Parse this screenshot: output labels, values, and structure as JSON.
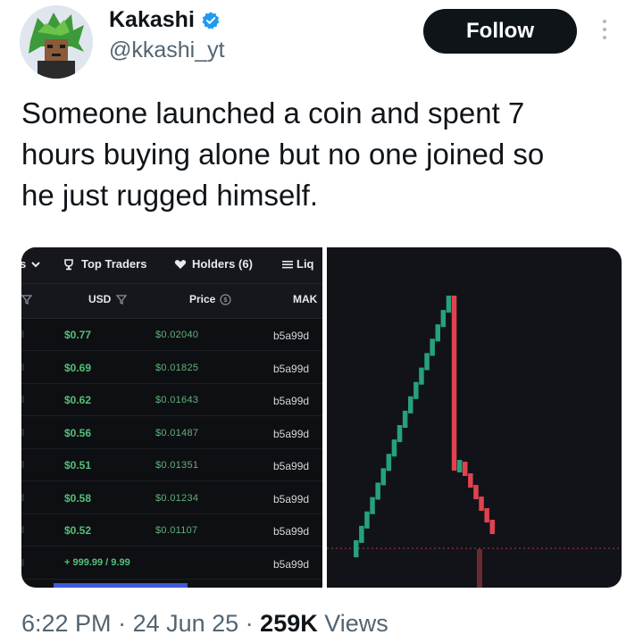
{
  "author": {
    "name": "Kakashi",
    "handle": "@kkashi_yt",
    "verified_icon": "verified-badge-icon",
    "avatar_icon": "green-haired-character-avatar"
  },
  "follow_label": "Follow",
  "tweet_text": "Someone launched a coin and spent 7\nhours buying alone but no one joined so\nhe just rugged himself.",
  "media": {
    "tabs": {
      "left_fragment": "s",
      "top_traders": "Top Traders",
      "holders": "Holders (6)",
      "liquidity_fragment": "Liq"
    },
    "columns": {
      "usd": "USD",
      "price": "Price",
      "maker": "MAK"
    },
    "trades": [
      {
        "usd": "$0.77",
        "price": "$0.02040",
        "maker": "b5a99d"
      },
      {
        "usd": "$0.69",
        "price": "$0.01825",
        "maker": "b5a99d"
      },
      {
        "usd": "$0.62",
        "price": "$0.01643",
        "maker": "b5a99d"
      },
      {
        "usd": "$0.56",
        "price": "$0.01487",
        "maker": "b5a99d"
      },
      {
        "usd": "$0.51",
        "price": "$0.01351",
        "maker": "b5a99d"
      },
      {
        "usd": "$0.58",
        "price": "$0.01234",
        "maker": "b5a99d"
      },
      {
        "usd": "$0.52",
        "price": "$0.01107",
        "maker": "b5a99d"
      },
      {
        "usd": "+ 999.99 / 9.99",
        "price": "",
        "maker": "b5a99d"
      }
    ],
    "colors": {
      "up": "#26a17b",
      "down": "#e0424f",
      "usd_green": "#52c07a",
      "panel_bg": "#111318"
    },
    "candles_up": 18,
    "candles_down": 7
  },
  "footer": {
    "time": "6:22 PM",
    "sep1": " · ",
    "date": "24 Jun 25",
    "sep2": " · ",
    "views_count": "259K",
    "views_label": " Views"
  }
}
